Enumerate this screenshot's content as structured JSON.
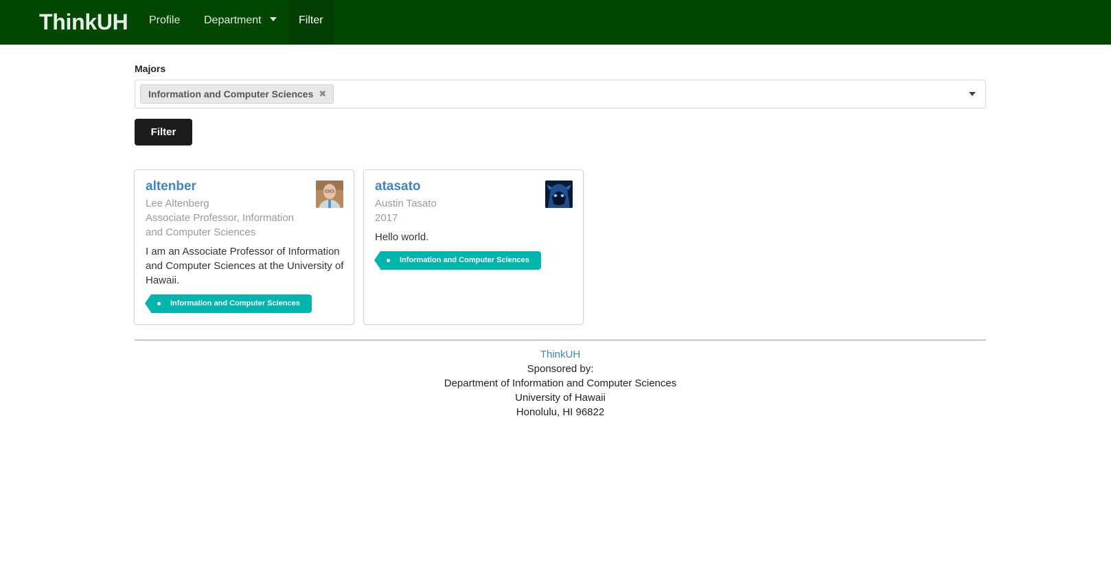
{
  "nav": {
    "brand": "ThinkUH",
    "items": [
      {
        "label": "Profile"
      },
      {
        "label": "Department"
      },
      {
        "label": "Filter"
      }
    ]
  },
  "form": {
    "label": "Majors",
    "selected_chip": "Information and Computer Sciences",
    "chip_remove": "✖",
    "button_label": "Filter"
  },
  "cards": [
    {
      "username": "altenber",
      "name": "Lee Altenberg",
      "meta": "Associate Professor, Information and Computer Sciences",
      "description": "I am an Associate Professor of Information and Computer Sciences at the University of Hawaii.",
      "tag": "Information and Computer Sciences"
    },
    {
      "username": "atasato",
      "name": "Austin Tasato",
      "meta": "2017",
      "description": "Hello world.",
      "tag": "Information and Computer Sciences"
    }
  ],
  "footer": {
    "link": "ThinkUH",
    "line1": "Sponsored by:",
    "line2": "Department of Information and Computer Sciences",
    "line3": "University of Hawaii",
    "line4": "Honolulu, HI 96822"
  },
  "colors": {
    "navbar": "#024702",
    "accent_link": "#4183c4",
    "tag": "#00b5ad",
    "button": "#1b1c1d"
  }
}
